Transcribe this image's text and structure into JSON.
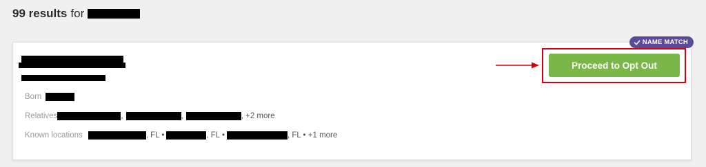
{
  "header": {
    "results_count": "99 results",
    "for_text": "for"
  },
  "badge": {
    "label": "NAME MATCH",
    "icon": "check-icon",
    "color": "#5b4a99"
  },
  "card": {
    "born_label": "Born",
    "relatives_label": "Relatives",
    "relatives_sep_1": ",",
    "relatives_sep_2": ",",
    "relatives_more": ", +2 more",
    "locations_label": "Known locations",
    "location_suffix_1": ", FL •",
    "location_suffix_2": ", FL •",
    "location_suffix_3": ", FL • +1 more",
    "cta_label": "Proceed to Opt Out"
  },
  "colors": {
    "cta": "#7ab648",
    "highlight": "#d9000d",
    "background": "#f0f0f0"
  }
}
